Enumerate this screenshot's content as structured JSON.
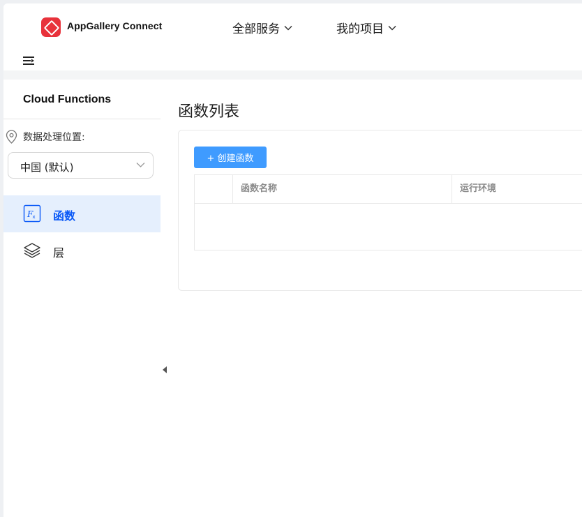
{
  "header": {
    "brand": "AppGallery Connect",
    "nav": [
      {
        "label": "全部服务"
      },
      {
        "label": "我的项目"
      }
    ]
  },
  "sidebar": {
    "title": "Cloud Functions",
    "location_label": "数据处理位置:",
    "region_select": {
      "value": "中国 (默认)"
    },
    "items": [
      {
        "label": "函数",
        "active": true,
        "icon": "function-fx-icon"
      },
      {
        "label": "层",
        "active": false,
        "icon": "layers-icon"
      }
    ]
  },
  "main": {
    "title": "函数列表",
    "create_button": "+ 创建函数",
    "table": {
      "columns": [
        "",
        "函数名称",
        "运行环境"
      ],
      "rows": []
    }
  },
  "colors": {
    "accent": "#0a59f7",
    "button": "#3f9bff",
    "active_bg": "#e5effd",
    "logo": "#e8323b"
  }
}
